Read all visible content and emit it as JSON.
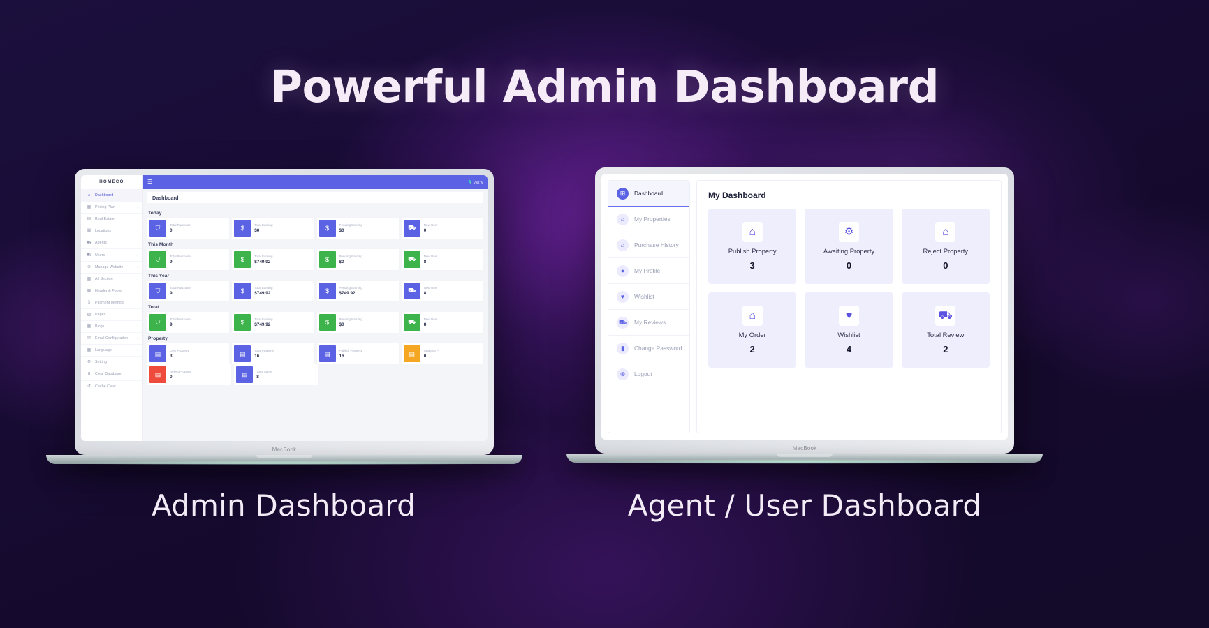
{
  "hero": {
    "title": "Powerful Admin Dashboard"
  },
  "captions": {
    "left": "Admin Dashboard",
    "right": "Agent / User Dashboard"
  },
  "colors": {
    "accent": "#5b62e3",
    "green": "#3cb44b",
    "orange": "#f5a623",
    "red": "#ef4b3c",
    "card_bg": "#efeefc",
    "page_bg": "#f4f5f9"
  },
  "admin": {
    "device_label": "MacBook",
    "logo": "HOMECO",
    "topbar": {
      "menu_icon": "hamburger-icon",
      "visit_label": "Visit W",
      "visit_icon": "globe-icon"
    },
    "breadcrumb": "Dashboard",
    "sidebar": [
      {
        "label": "Dashboard",
        "icon": "home-icon",
        "arrow": "",
        "active": true
      },
      {
        "label": "Pricing Plan",
        "icon": "grid-icon",
        "arrow": "›",
        "active": false
      },
      {
        "label": "Real Estate",
        "icon": "building-icon",
        "arrow": "›",
        "active": false
      },
      {
        "label": "Locations",
        "icon": "pin-icon",
        "arrow": "›",
        "active": false
      },
      {
        "label": "Agents",
        "icon": "users-icon",
        "arrow": "›",
        "active": false
      },
      {
        "label": "Users",
        "icon": "users-icon",
        "arrow": "›",
        "active": false
      },
      {
        "label": "Manage Website",
        "icon": "globe-icon",
        "arrow": "›",
        "active": false
      },
      {
        "label": "All Section",
        "icon": "grid-icon",
        "arrow": "›",
        "active": false
      },
      {
        "label": "Header & Footer",
        "icon": "grid-icon",
        "arrow": "›",
        "active": false
      },
      {
        "label": "Payment Method",
        "icon": "dollar-icon",
        "arrow": "",
        "active": false
      },
      {
        "label": "Pages",
        "icon": "layout-icon",
        "arrow": "›",
        "active": false
      },
      {
        "label": "Blogs",
        "icon": "grid-icon",
        "arrow": "›",
        "active": false
      },
      {
        "label": "Email Configuration",
        "icon": "mail-icon",
        "arrow": "›",
        "active": false
      },
      {
        "label": "Language",
        "icon": "grid-icon",
        "arrow": "›",
        "active": false
      },
      {
        "label": "Setting",
        "icon": "gear-icon",
        "arrow": "",
        "active": false
      },
      {
        "label": "Clear Database",
        "icon": "trash-icon",
        "arrow": "",
        "active": false
      },
      {
        "label": "Cache Clear",
        "icon": "refresh-icon",
        "arrow": "",
        "active": false
      }
    ],
    "sections": [
      {
        "title": "Today",
        "cards": [
          {
            "label": "Total Purchase",
            "value": "0",
            "icon": "cart-icon",
            "color": "#5b62e3"
          },
          {
            "label": "Total Earning",
            "value": "$0",
            "icon": "dollar-icon",
            "color": "#5b62e3"
          },
          {
            "label": "Pending Earning",
            "value": "$0",
            "icon": "dollar-icon",
            "color": "#5b62e3"
          },
          {
            "label": "New User",
            "value": "0",
            "icon": "users-icon",
            "color": "#5b62e3"
          }
        ]
      },
      {
        "title": "This Month",
        "cards": [
          {
            "label": "Total Purchase",
            "value": "9",
            "icon": "cart-icon",
            "color": "#3cb44b"
          },
          {
            "label": "Total Earning",
            "value": "$749.92",
            "icon": "dollar-icon",
            "color": "#3cb44b"
          },
          {
            "label": "Pending Earning",
            "value": "$0",
            "icon": "dollar-icon",
            "color": "#3cb44b"
          },
          {
            "label": "New User",
            "value": "8",
            "icon": "users-icon",
            "color": "#3cb44b"
          }
        ]
      },
      {
        "title": "This Year",
        "cards": [
          {
            "label": "Total Purchase",
            "value": "9",
            "icon": "cart-icon",
            "color": "#5b62e3"
          },
          {
            "label": "Total Earning",
            "value": "$749.92",
            "icon": "dollar-icon",
            "color": "#5b62e3"
          },
          {
            "label": "Pending Earning",
            "value": "$749.92",
            "icon": "dollar-icon",
            "color": "#5b62e3"
          },
          {
            "label": "New User",
            "value": "8",
            "icon": "users-icon",
            "color": "#5b62e3"
          }
        ]
      },
      {
        "title": "Total",
        "cards": [
          {
            "label": "Total Purchase",
            "value": "9",
            "icon": "cart-icon",
            "color": "#3cb44b"
          },
          {
            "label": "Total Earning",
            "value": "$749.92",
            "icon": "dollar-icon",
            "color": "#3cb44b"
          },
          {
            "label": "Pending Earning",
            "value": "$0",
            "icon": "dollar-icon",
            "color": "#3cb44b"
          },
          {
            "label": "New User",
            "value": "8",
            "icon": "users-icon",
            "color": "#3cb44b"
          }
        ]
      },
      {
        "title": "Property",
        "cards": [
          {
            "label": "Own Property",
            "value": "3",
            "icon": "building-icon",
            "color": "#5b62e3"
          },
          {
            "label": "Total Property",
            "value": "16",
            "icon": "building-icon",
            "color": "#5b62e3"
          },
          {
            "label": "Publish Property",
            "value": "16",
            "icon": "building-icon",
            "color": "#5b62e3"
          },
          {
            "label": "Awaiting Pr",
            "value": "0",
            "icon": "building-icon",
            "color": "#f5a623"
          }
        ]
      },
      {
        "title": "",
        "cards": [
          {
            "label": "Reject Property",
            "value": "0",
            "icon": "building-icon",
            "color": "#ef4b3c"
          },
          {
            "label": "Total Agent",
            "value": "8",
            "icon": "building-icon",
            "color": "#5b62e3"
          }
        ]
      }
    ]
  },
  "agent": {
    "device_label": "MacBook",
    "panel_title": "My Dashboard",
    "sidebar": [
      {
        "label": "Dashboard",
        "icon": "dashboard-grid-icon",
        "active": true
      },
      {
        "label": "My Properties",
        "icon": "home-icon",
        "active": false
      },
      {
        "label": "Purchase History",
        "icon": "hand-house-icon",
        "active": false
      },
      {
        "label": "My Profile",
        "icon": "user-icon",
        "active": false
      },
      {
        "label": "Wishlist",
        "icon": "heart-icon",
        "active": false
      },
      {
        "label": "My Reviews",
        "icon": "review-users-icon",
        "active": false
      },
      {
        "label": "Change Password",
        "icon": "lock-icon",
        "active": false
      },
      {
        "label": "Logout",
        "icon": "logout-icon",
        "active": false
      }
    ],
    "cards": [
      {
        "label": "Publish Property",
        "value": "3",
        "icon": "home-icon"
      },
      {
        "label": "Awaiting Property",
        "value": "0",
        "icon": "gear-home-icon"
      },
      {
        "label": "Reject Property",
        "value": "0",
        "icon": "home-icon"
      },
      {
        "label": "My Order",
        "value": "2",
        "icon": "hand-house-icon"
      },
      {
        "label": "Wishlist",
        "value": "4",
        "icon": "heart-icon"
      },
      {
        "label": "Total Review",
        "value": "2",
        "icon": "review-users-icon"
      }
    ]
  }
}
